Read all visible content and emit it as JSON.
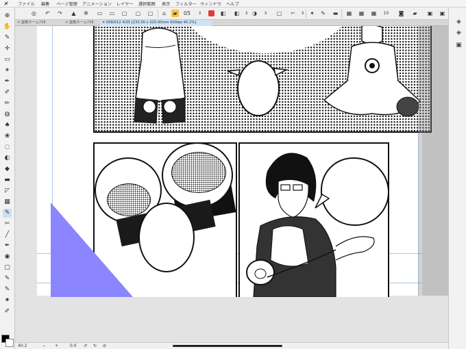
{
  "menu": [
    "ファイル",
    "編集",
    "ページ管理",
    "アニメーション",
    "レイヤー",
    "選択範囲",
    "表示",
    "フィルター",
    "ウィンドウ",
    "ヘルプ"
  ],
  "command_bar": {
    "brush_size": "05",
    "colors": {
      "accent_red": "#e53935",
      "active_blue": "#cde0f3"
    },
    "counter": "10"
  },
  "tabs": [
    {
      "label": "座敷ネーム758",
      "active": false
    },
    {
      "label": "座敷ネーム758",
      "active": false
    },
    {
      "label": "008/012 4(35 [233.00 x 325.00mm 600dpi 40.2%]",
      "active": true
    }
  ],
  "status": {
    "zoom": "40.2",
    "rotation": "0.0"
  },
  "selection_triangle_color": "#8b86ff",
  "canvas_colors": {
    "page": "#ffffff",
    "panel_border": "#111111"
  }
}
